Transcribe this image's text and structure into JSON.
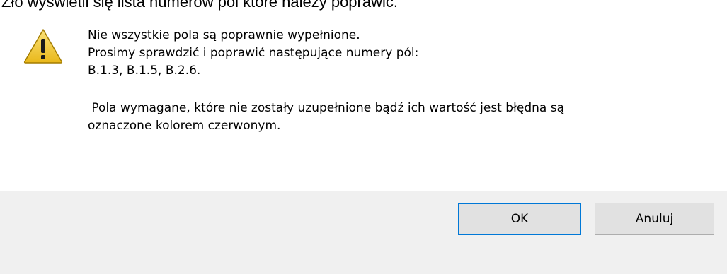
{
  "background_text": "Zło wyświetli się lista numerów pól które należy poprawić.",
  "dialog": {
    "icon": "warning-icon",
    "message_lines": [
      "Nie wszystkie pola są poprawnie wypełnione.",
      "Prosimy sprawdzić i poprawić następujące numery pól:",
      "B.1.3, B.1.5, B.2.6."
    ],
    "note_lines": [
      " Pola wymagane, które nie zostały uzupełnione bądź ich wartość jest błędna są",
      "oznaczone kolorem czerwonym."
    ],
    "buttons": {
      "ok_label": "OK",
      "cancel_label": "Anuluj"
    }
  },
  "colors": {
    "dialog_background": "#f0f0f0",
    "button_background": "#e1e1e1",
    "focus_border": "#0078d7",
    "warning_fill": "#f7d33b"
  }
}
